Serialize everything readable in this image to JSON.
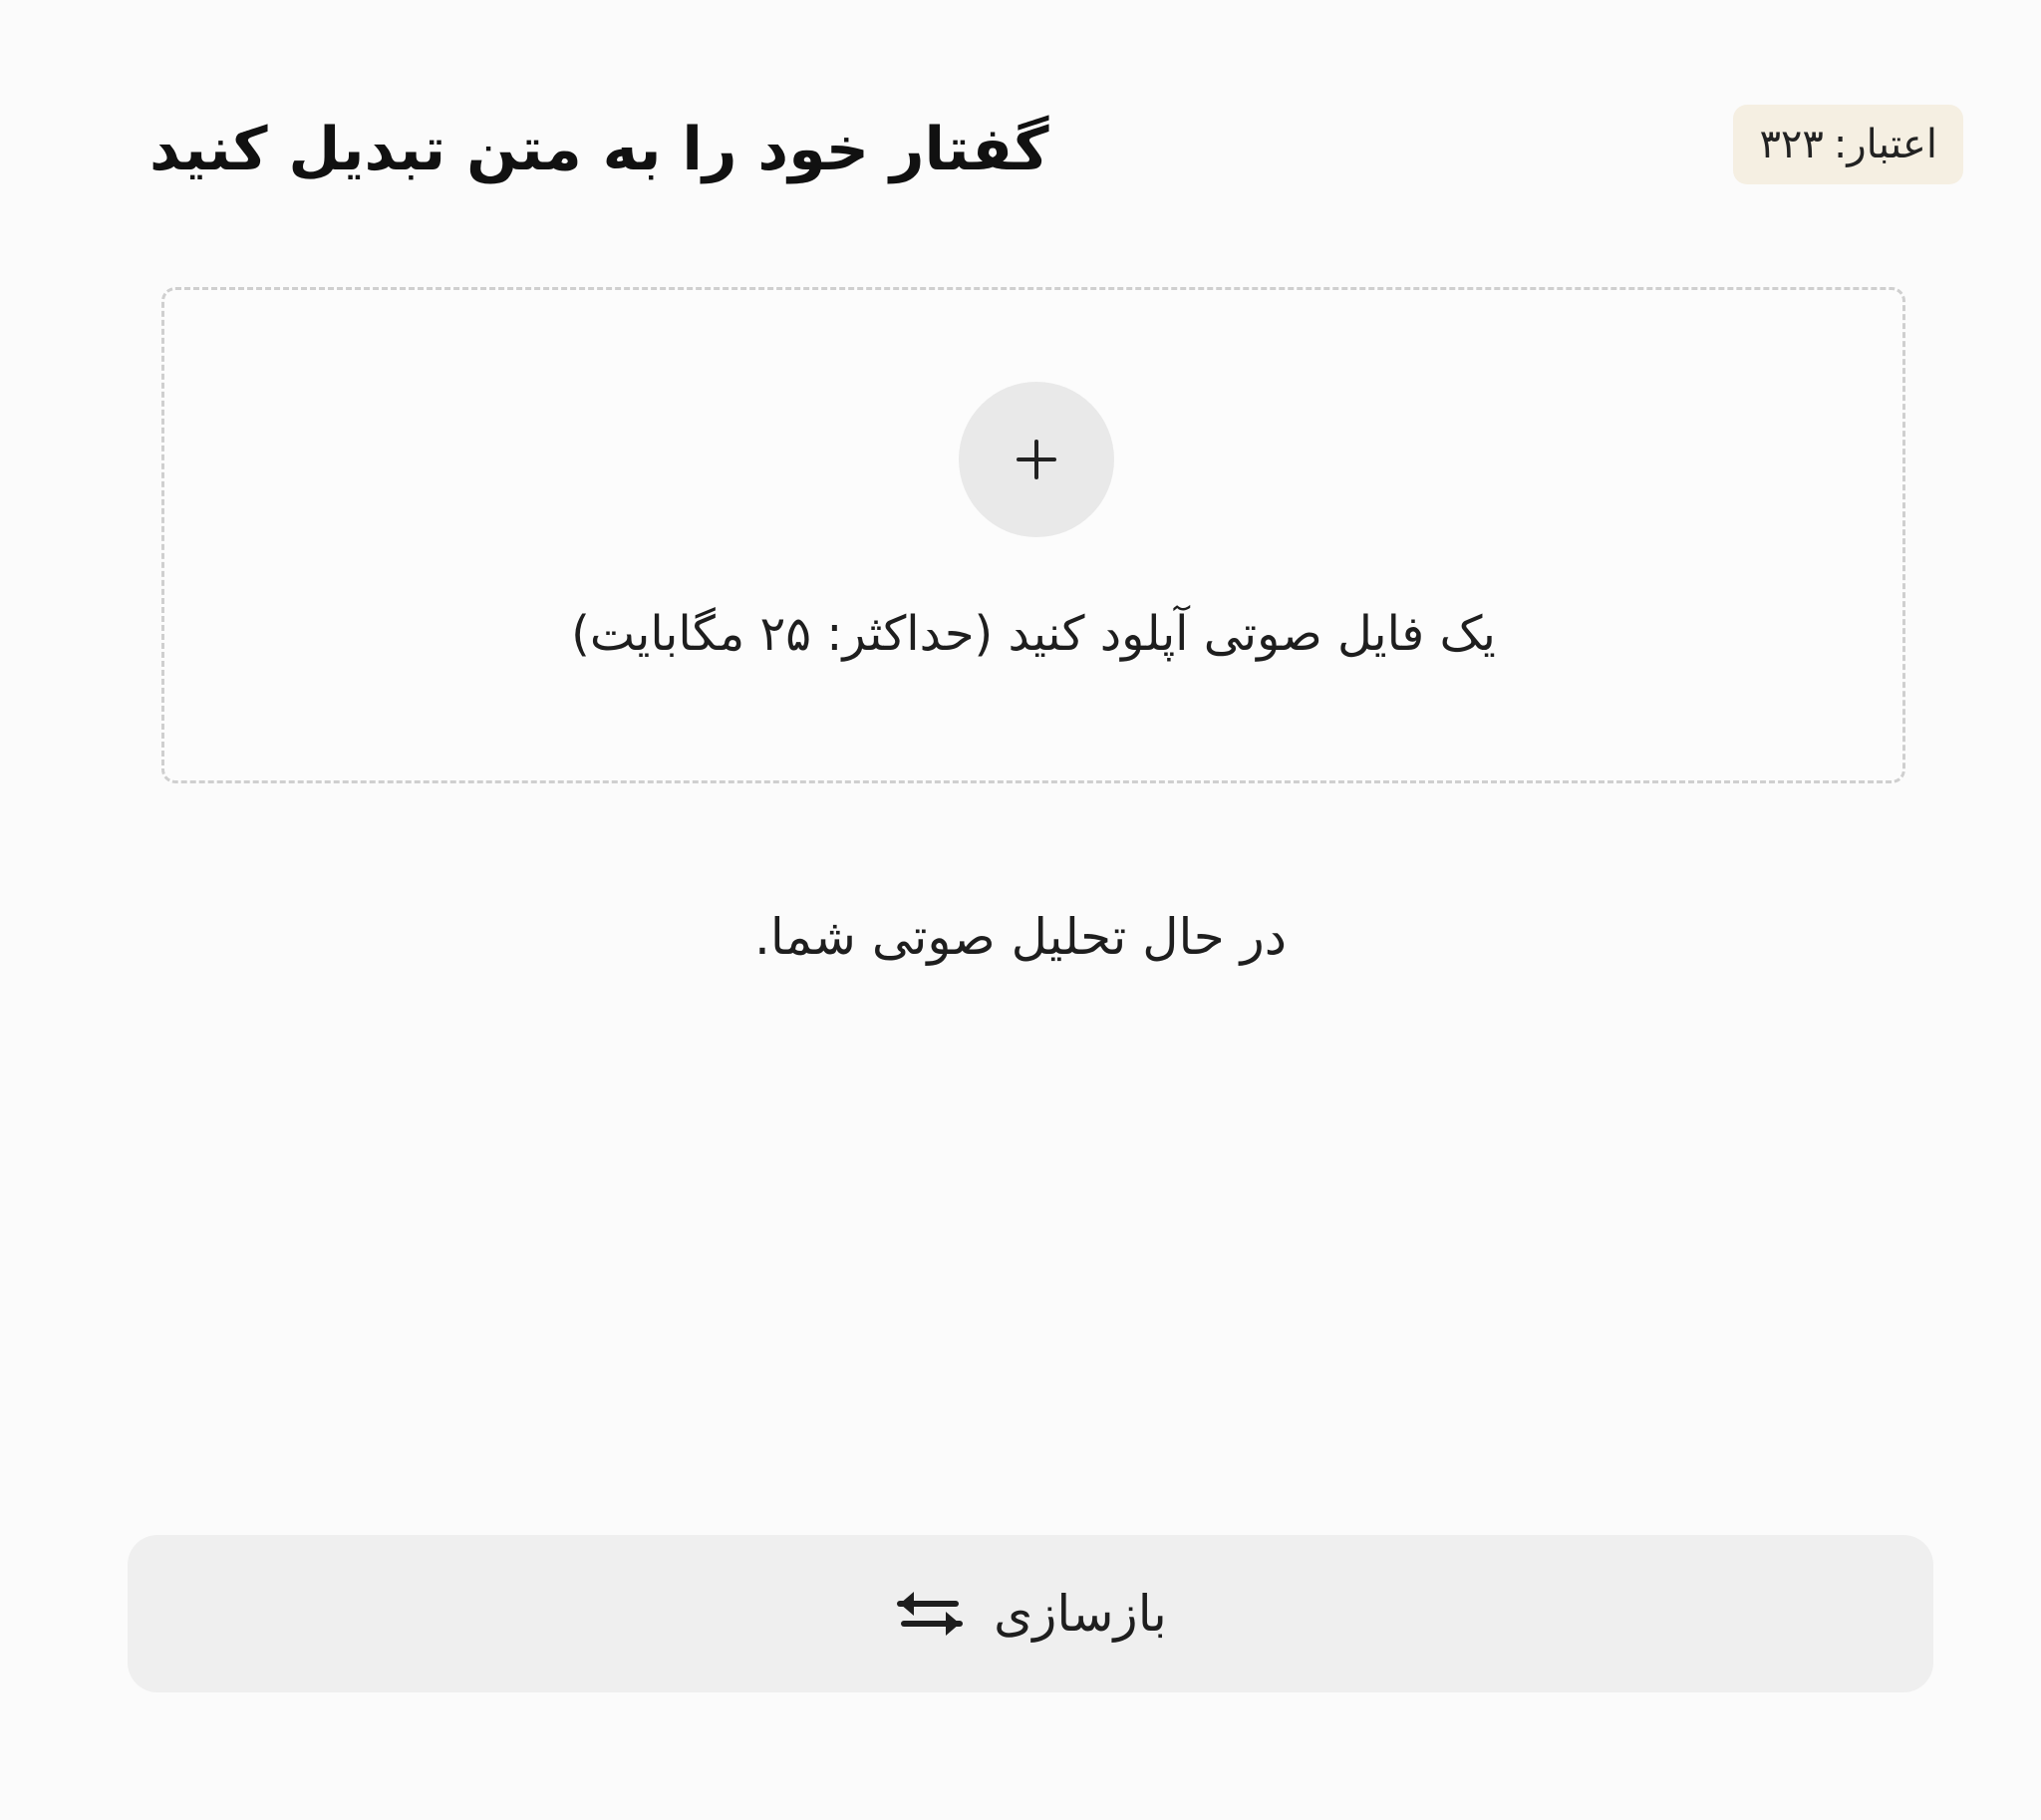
{
  "header": {
    "title": "گفتار خود را به متن تبدیل کنید",
    "credit_label": "اعتبار:",
    "credit_value": "۳۲۳"
  },
  "upload": {
    "instruction": "یک فایل صوتی آپلود کنید (حداکثر: ۲۵ مگابایت)",
    "icon": "plus-icon"
  },
  "status": {
    "message": "در حال تحلیل صوتی شما."
  },
  "waveform": {
    "gradient_colors": [
      "#b06ab3",
      "#9a8fb8",
      "#7bc8c9",
      "#8aa6b8"
    ]
  },
  "rebuild": {
    "label": "بازسازی",
    "icon": "swap-arrows-icon"
  }
}
